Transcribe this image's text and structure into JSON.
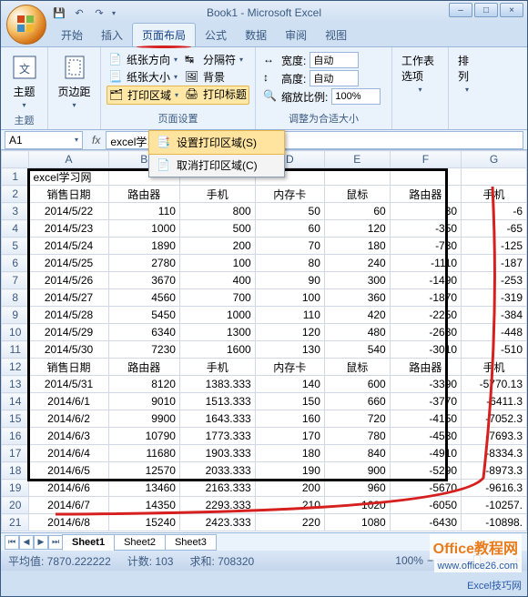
{
  "window": {
    "title": "Book1 - Microsoft Excel"
  },
  "tabs": [
    "开始",
    "插入",
    "页面布局",
    "公式",
    "数据",
    "审阅",
    "视图"
  ],
  "active_tab": 2,
  "ribbon": {
    "g1": {
      "label": "主题",
      "themes": "主题"
    },
    "g2": {
      "label": "页面设置",
      "margins": "页边距",
      "orientation": "纸张方向",
      "size": "纸张大小",
      "print_area": "打印区域",
      "breaks": "分隔符",
      "background": "背景",
      "titles": "打印标题"
    },
    "g3": {
      "label": "调整为合适大小",
      "width": "宽度:",
      "height": "高度:",
      "scale": "缩放比例:",
      "auto": "自动",
      "scale_val": "100%"
    },
    "g4": {
      "label": "",
      "options": "工作表选项"
    },
    "g5": {
      "label": "",
      "arrange": "排列"
    }
  },
  "dropdown": {
    "set": "设置打印区域(S)",
    "clear": "取消打印区域(C)"
  },
  "namebox": "A1",
  "formula": "excel学习网",
  "cols": [
    "A",
    "B",
    "C",
    "D",
    "E",
    "F",
    "G"
  ],
  "rows": [
    {
      "n": 1,
      "c": [
        "excel学习网",
        "",
        "",
        "",
        "",
        "",
        ""
      ]
    },
    {
      "n": 2,
      "c": [
        "销售日期",
        "路由器",
        "手机",
        "内存卡",
        "鼠标",
        "路由器",
        "手机"
      ]
    },
    {
      "n": 3,
      "c": [
        "2014/5/22",
        "110",
        "800",
        "50",
        "60",
        "30",
        "-6"
      ]
    },
    {
      "n": 4,
      "c": [
        "2014/5/23",
        "1000",
        "500",
        "60",
        "120",
        "-350",
        "-65"
      ]
    },
    {
      "n": 5,
      "c": [
        "2014/5/24",
        "1890",
        "200",
        "70",
        "180",
        "-730",
        "-125"
      ]
    },
    {
      "n": 6,
      "c": [
        "2014/5/25",
        "2780",
        "100",
        "80",
        "240",
        "-1110",
        "-187"
      ]
    },
    {
      "n": 7,
      "c": [
        "2014/5/26",
        "3670",
        "400",
        "90",
        "300",
        "-1490",
        "-253"
      ]
    },
    {
      "n": 8,
      "c": [
        "2014/5/27",
        "4560",
        "700",
        "100",
        "360",
        "-1870",
        "-319"
      ]
    },
    {
      "n": 9,
      "c": [
        "2014/5/28",
        "5450",
        "1000",
        "110",
        "420",
        "-2250",
        "-384"
      ]
    },
    {
      "n": 10,
      "c": [
        "2014/5/29",
        "6340",
        "1300",
        "120",
        "480",
        "-2630",
        "-448"
      ]
    },
    {
      "n": 11,
      "c": [
        "2014/5/30",
        "7230",
        "1600",
        "130",
        "540",
        "-3010",
        "-510"
      ]
    },
    {
      "n": 12,
      "c": [
        "销售日期",
        "路由器",
        "手机",
        "内存卡",
        "鼠标",
        "路由器",
        "手机"
      ]
    },
    {
      "n": 13,
      "c": [
        "2014/5/31",
        "8120",
        "1383.333",
        "140",
        "600",
        "-3390",
        "-5770.13"
      ]
    },
    {
      "n": 14,
      "c": [
        "2014/6/1",
        "9010",
        "1513.333",
        "150",
        "660",
        "-3770",
        "-6411.3"
      ]
    },
    {
      "n": 15,
      "c": [
        "2014/6/2",
        "9900",
        "1643.333",
        "160",
        "720",
        "-4150",
        "-7052.3"
      ]
    },
    {
      "n": 16,
      "c": [
        "2014/6/3",
        "10790",
        "1773.333",
        "170",
        "780",
        "-4530",
        "-7693.3"
      ]
    },
    {
      "n": 17,
      "c": [
        "2014/6/4",
        "11680",
        "1903.333",
        "180",
        "840",
        "-4910",
        "-8334.3"
      ]
    },
    {
      "n": 18,
      "c": [
        "2014/6/5",
        "12570",
        "2033.333",
        "190",
        "900",
        "-5290",
        "-8973.3"
      ]
    },
    {
      "n": 19,
      "c": [
        "2014/6/6",
        "13460",
        "2163.333",
        "200",
        "960",
        "-5670",
        "-9616.3"
      ]
    },
    {
      "n": 20,
      "c": [
        "2014/6/7",
        "14350",
        "2293.333",
        "210",
        "1020",
        "-6050",
        "-10257."
      ]
    },
    {
      "n": 21,
      "c": [
        "2014/6/8",
        "15240",
        "2423.333",
        "220",
        "1080",
        "-6430",
        "-10898."
      ]
    }
  ],
  "sheets": [
    "Sheet1",
    "Sheet2",
    "Sheet3"
  ],
  "status": {
    "avg": "平均值: 7870.222222",
    "count": "计数: 103",
    "sum": "求和: 708320",
    "zoom": "100%"
  },
  "watermark": {
    "l1": "Office教程网",
    "l2": "www.office26.com",
    "l3": "Excel技巧网"
  },
  "icons": {
    "min": "–",
    "max": "□",
    "close": "×"
  }
}
